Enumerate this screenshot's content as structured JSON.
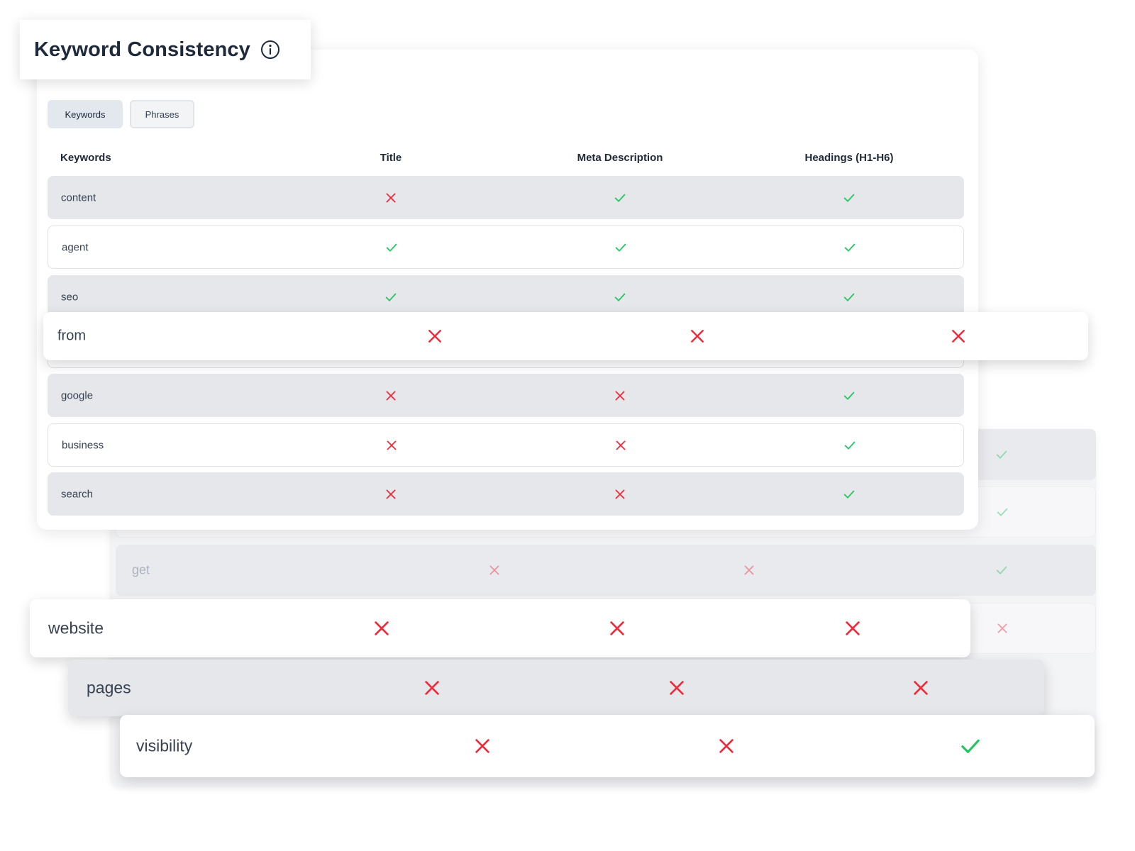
{
  "header": {
    "title": "Keyword Consistency",
    "info_icon": "info-circle-icon"
  },
  "tabs": [
    {
      "label": "Keywords",
      "active": true
    },
    {
      "label": "Phrases",
      "active": false
    }
  ],
  "columns": [
    "Keywords",
    "Title",
    "Meta Description",
    "Headings (H1-H6)"
  ],
  "rows": [
    {
      "keyword": "content",
      "title": "cross",
      "meta": "check",
      "headings": "check"
    },
    {
      "keyword": "agent",
      "title": "check",
      "meta": "check",
      "headings": "check"
    },
    {
      "keyword": "seo",
      "title": "check",
      "meta": "check",
      "headings": "check"
    },
    {
      "keyword": "google",
      "title": "cross",
      "meta": "cross",
      "headings": "check"
    },
    {
      "keyword": "business",
      "title": "cross",
      "meta": "cross",
      "headings": "check"
    },
    {
      "keyword": "search",
      "title": "cross",
      "meta": "cross",
      "headings": "check"
    }
  ],
  "highlighted_rows": [
    {
      "keyword": "from",
      "title": "cross",
      "meta": "cross",
      "headings": "cross"
    },
    {
      "keyword": "website",
      "title": "cross",
      "meta": "cross",
      "headings": "cross"
    },
    {
      "keyword": "pages",
      "title": "cross",
      "meta": "cross",
      "headings": "cross"
    },
    {
      "keyword": "visibility",
      "title": "cross",
      "meta": "cross",
      "headings": "check"
    }
  ],
  "background_rows": [
    {
      "keyword": "",
      "headings": "check"
    },
    {
      "keyword": "",
      "headings": "check"
    },
    {
      "keyword": "get",
      "title": "cross",
      "meta": "cross",
      "headings": "check"
    },
    {
      "keyword": "",
      "headings": "cross"
    }
  ],
  "colors": {
    "check": "#22c55e",
    "cross": "#ef2b3b"
  }
}
